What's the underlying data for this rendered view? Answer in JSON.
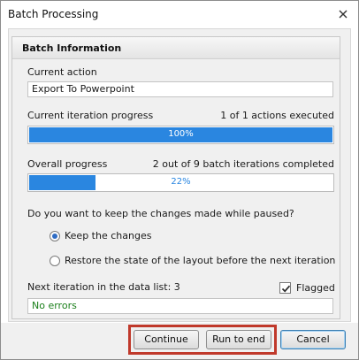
{
  "window": {
    "title": "Batch Processing"
  },
  "group": {
    "title": "Batch Information"
  },
  "current_action": {
    "label": "Current action",
    "value": "Export To Powerpoint"
  },
  "iteration_progress": {
    "label": "Current iteration progress",
    "status": "1 of 1 actions executed",
    "percent_text": "100%",
    "fraction": 1.0
  },
  "overall_progress": {
    "label": "Overall progress",
    "status": "2 out of 9 batch iterations completed",
    "percent_text": "22%",
    "fraction": 0.22
  },
  "paused_question": "Do you want to keep the changes made while paused?",
  "options": [
    {
      "label": "Keep the changes",
      "checked": true
    },
    {
      "label": "Restore the state of the layout before the next iteration",
      "checked": false
    }
  ],
  "next_iteration": "Next iteration in the data list: 3",
  "flagged": {
    "label": "Flagged",
    "checked": true
  },
  "status_message": "No errors",
  "buttons": {
    "continue": "Continue",
    "run_to_end": "Run to end",
    "cancel": "Cancel"
  },
  "colors": {
    "progress_fill": "#2a86e0",
    "status_text": "#1a7f1a",
    "highlight_border": "#c0392b"
  }
}
